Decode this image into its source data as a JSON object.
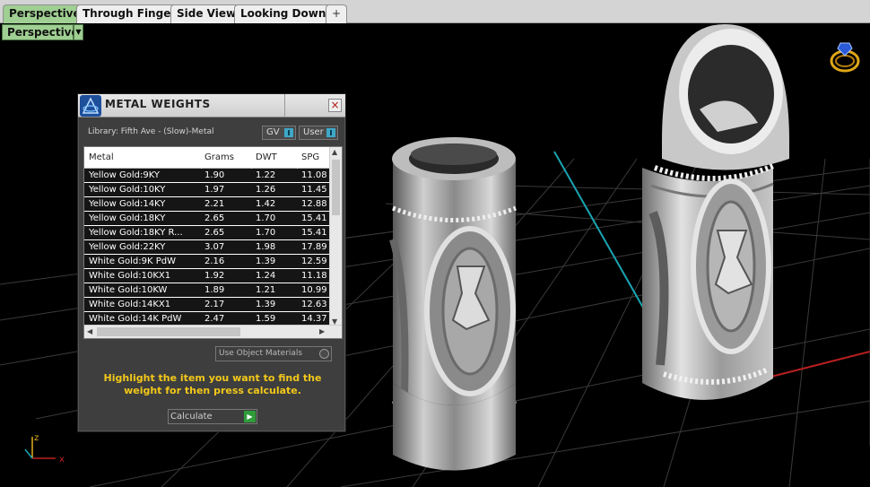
{
  "tabs": [
    {
      "label": "Perspective",
      "active": true
    },
    {
      "label": "Through Finger",
      "active": false
    },
    {
      "label": "Side View",
      "active": false
    },
    {
      "label": "Looking Down",
      "active": false
    }
  ],
  "add_tab_symbol": "+",
  "viewport": {
    "label": "Perspective",
    "axis": {
      "z": "z",
      "x": "x"
    }
  },
  "panel": {
    "title": "METAL WEIGHTS",
    "close_symbol": "×",
    "library": "Library: Fifth Ave - (Slow)-Metal",
    "toggles": {
      "gv": "GV",
      "user": "User"
    },
    "columns": [
      "Metal",
      "Grams",
      "DWT",
      "SPG"
    ],
    "rows": [
      [
        "Yellow Gold:9KY",
        "1.90",
        "1.22",
        "11.08"
      ],
      [
        "Yellow Gold:10KY",
        "1.97",
        "1.26",
        "11.45"
      ],
      [
        "Yellow Gold:14KY",
        "2.21",
        "1.42",
        "12.88"
      ],
      [
        "Yellow Gold:18KY",
        "2.65",
        "1.70",
        "15.41"
      ],
      [
        "Yellow Gold:18KY R...",
        "2.65",
        "1.70",
        "15.41"
      ],
      [
        "Yellow Gold:22KY",
        "3.07",
        "1.98",
        "17.89"
      ],
      [
        "White Gold:9K PdW",
        "2.16",
        "1.39",
        "12.59"
      ],
      [
        "White Gold:10KX1",
        "1.92",
        "1.24",
        "11.18"
      ],
      [
        "White Gold:10KW",
        "1.89",
        "1.21",
        "10.99"
      ],
      [
        "White Gold:14KX1",
        "2.17",
        "1.39",
        "12.63"
      ],
      [
        "White Gold:14K PdW",
        "2.47",
        "1.59",
        "14.37"
      ]
    ],
    "use_object_materials": "Use Object Materials",
    "hint": "Highlight the item you want to find the weight for then press calculate.",
    "calculate": "Calculate"
  }
}
